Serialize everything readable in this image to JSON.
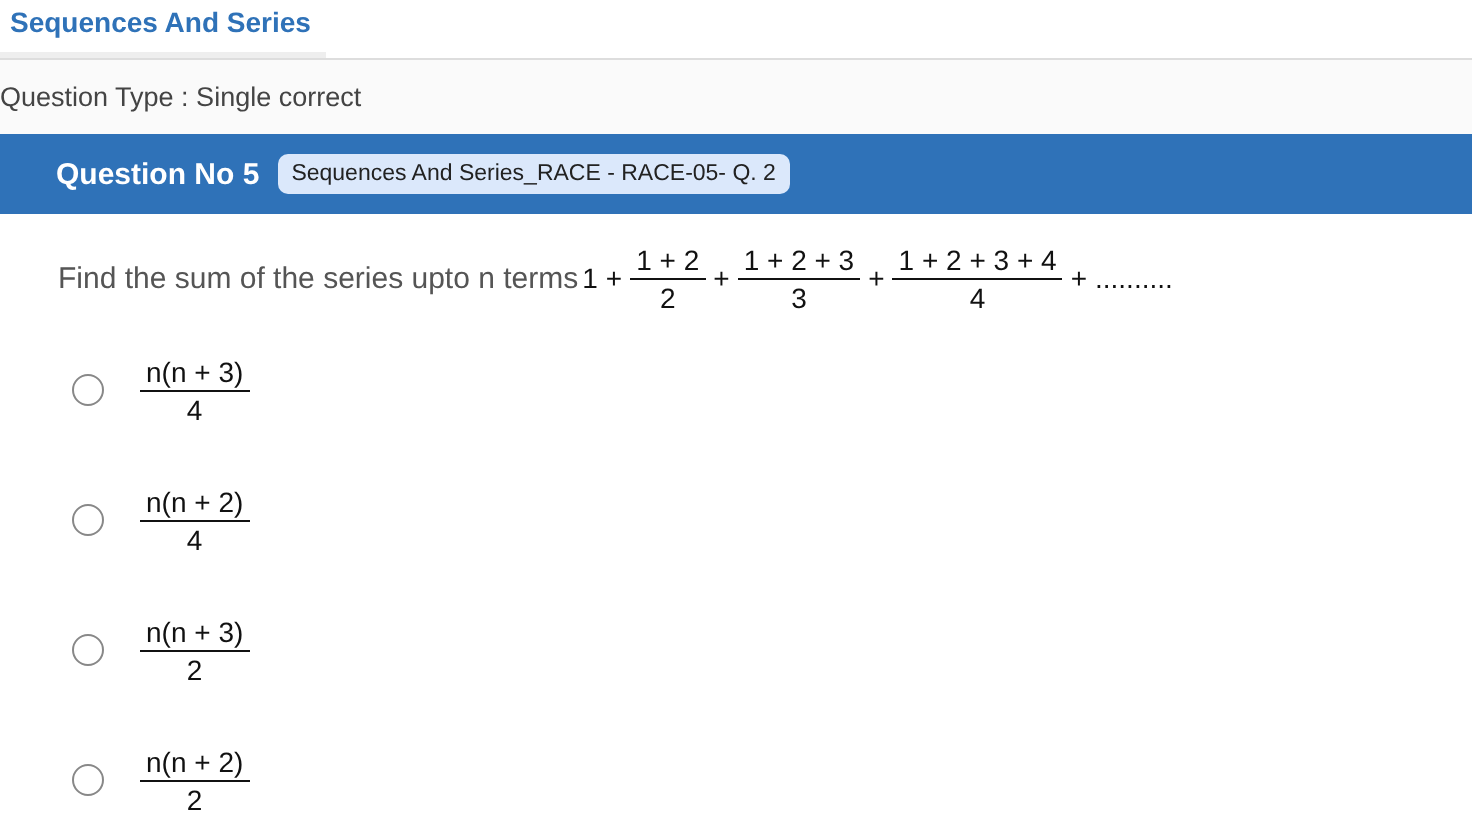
{
  "tab": {
    "label": "Sequences And Series",
    "selected": true
  },
  "question_type": "Question Type : Single correct",
  "header": {
    "title": "Question No 5",
    "tag": "Sequences And Series_RACE - RACE-05- Q. 2"
  },
  "question": {
    "text": "Find the sum of the series upto n terms",
    "expression": [
      {
        "kind": "term",
        "text": "1"
      },
      {
        "kind": "op",
        "text": "+"
      },
      {
        "kind": "fraction",
        "numerator": "1 + 2",
        "denominator": "2"
      },
      {
        "kind": "op",
        "text": "+"
      },
      {
        "kind": "fraction",
        "numerator": "1 + 2 + 3",
        "denominator": "3"
      },
      {
        "kind": "op",
        "text": "+"
      },
      {
        "kind": "fraction",
        "numerator": "1 + 2 + 3 + 4",
        "denominator": "4"
      },
      {
        "kind": "op",
        "text": "+"
      },
      {
        "kind": "term",
        "text": ".........."
      }
    ]
  },
  "options": [
    {
      "numerator": "n(n + 3)",
      "denominator": "4",
      "selected": false
    },
    {
      "numerator": "n(n + 2)",
      "denominator": "4",
      "selected": false
    },
    {
      "numerator": "n(n + 3)",
      "denominator": "2",
      "selected": false
    },
    {
      "numerator": "n(n + 2)",
      "denominator": "2",
      "selected": false
    }
  ]
}
